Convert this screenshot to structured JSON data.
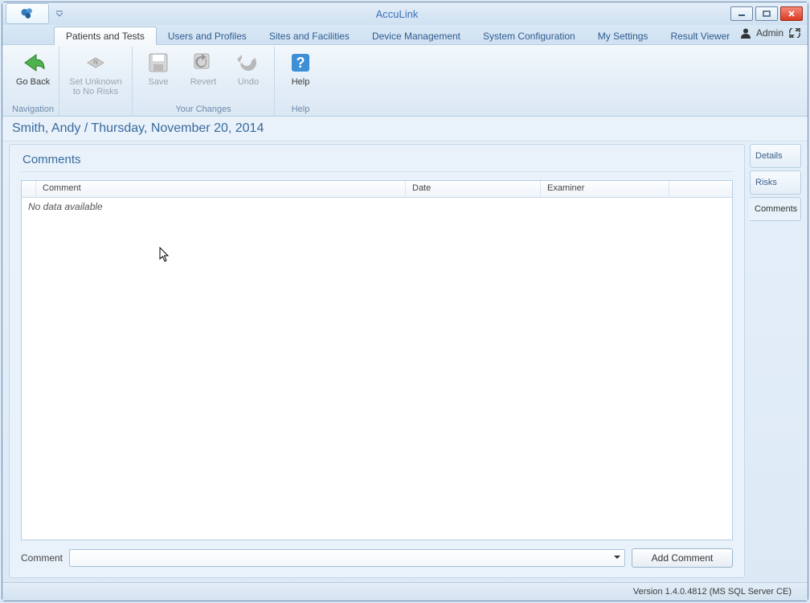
{
  "app": {
    "title": "AccuLink"
  },
  "tabs": {
    "patients": "Patients and Tests",
    "users": "Users and Profiles",
    "sites": "Sites and Facilities",
    "device": "Device Management",
    "system": "System Configuration",
    "settings": "My Settings",
    "results": "Result Viewer"
  },
  "user": {
    "name": "Admin"
  },
  "ribbon": {
    "nav": {
      "goback": "Go Back",
      "group": "Navigation"
    },
    "changes": {
      "setunknown": "Set Unknown to No Risks",
      "save": "Save",
      "revert": "Revert",
      "undo": "Undo",
      "group": "Your Changes"
    },
    "help": {
      "help": "Help",
      "group": "Help"
    }
  },
  "breadcrumb": "Smith, Andy / Thursday, November 20, 2014",
  "panel": {
    "title": "Comments",
    "columns": {
      "comment": "Comment",
      "date": "Date",
      "examiner": "Examiner"
    },
    "empty": "No data available",
    "comment_label": "Comment",
    "add_button": "Add Comment"
  },
  "sidetabs": {
    "details": "Details",
    "risks": "Risks",
    "comments": "Comments"
  },
  "status": "Version 1.4.0.4812 (MS SQL Server CE)"
}
